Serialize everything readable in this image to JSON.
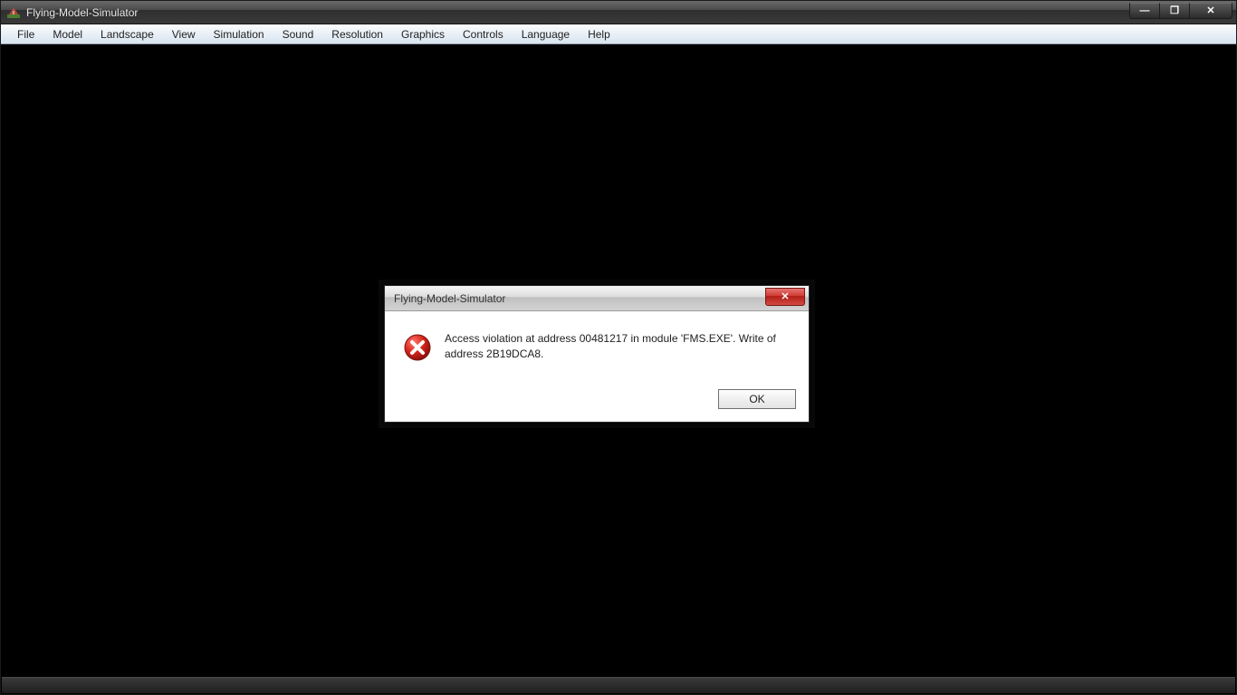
{
  "window": {
    "title": "Flying-Model-Simulator",
    "icon_name": "app"
  },
  "window_controls": {
    "minimize_glyph": "—",
    "maximize_glyph": "❐",
    "close_glyph": "✕"
  },
  "menu": {
    "items": [
      "File",
      "Model",
      "Landscape",
      "View",
      "Simulation",
      "Sound",
      "Resolution",
      "Graphics",
      "Controls",
      "Language",
      "Help"
    ]
  },
  "dialog": {
    "title": "Flying-Model-Simulator",
    "icon_name": "error",
    "message": "Access violation at address 00481217 in module 'FMS.EXE'. Write of address 2B19DCA8.",
    "close_glyph": "✕",
    "ok_label": "OK"
  }
}
